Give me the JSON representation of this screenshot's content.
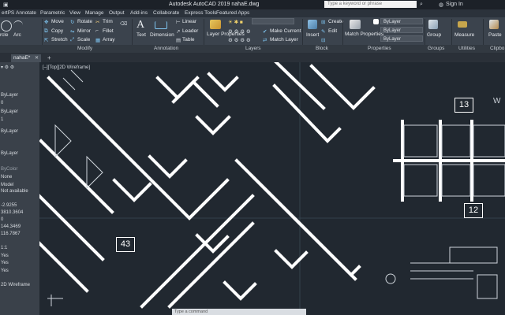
{
  "titlebar": {
    "title": "Autodesk AutoCAD 2019    nahaE.dwg",
    "search_placeholder": "Type a keyword or phrase",
    "signin": "Sign In"
  },
  "menu": [
    "ertPS",
    "Annotate",
    "Parametric",
    "View",
    "Manage",
    "Output",
    "Add-ins",
    "Collaborate",
    "Express Tools",
    "Featured Apps"
  ],
  "ribbon": {
    "draw": [
      "rcle",
      "Arc"
    ],
    "modify": [
      "Move",
      "Rotate",
      "Trim",
      "Copy",
      "Mirror",
      "Fillet",
      "Stretch",
      "Scale",
      "Array"
    ],
    "annotation": [
      "Text",
      "Dimension",
      "Linear",
      "Leader",
      "Table"
    ],
    "layers": [
      "Layer Properties",
      "Make Current",
      "Match Layer"
    ],
    "block": [
      "Insert",
      "Create",
      "Edit"
    ],
    "properties": [
      "Match Properties",
      "ByLayer",
      "ByLayer",
      "ByLayer"
    ],
    "groups": "Group",
    "utilities": "Measure",
    "clipboard": "Paste"
  },
  "panels": [
    "Modify",
    "Annotation",
    "Layers",
    "Block",
    "Properties",
    "Groups",
    "Utilities",
    "Clipbo"
  ],
  "file_tab": "nahaE*",
  "viewport_label": "[–][Top][2D Wireframe]",
  "properties_panel": [
    {
      "text": "ByLayer",
      "dim": false
    },
    {
      "text": "0",
      "dim": false
    },
    {
      "text": "ByLayer",
      "dim": false
    },
    {
      "text": "1",
      "dim": false
    },
    {
      "text": "ByLayer",
      "dim": false
    },
    {
      "text": "ByLayer",
      "dim": false
    },
    {
      "text": "ByColor",
      "dim": true
    },
    {
      "text": "None",
      "dim": false
    },
    {
      "text": "Model",
      "dim": false
    },
    {
      "text": "Not available",
      "dim": false
    },
    {
      "text": "-2.9255",
      "dim": false
    },
    {
      "text": "3810.3604",
      "dim": false
    },
    {
      "text": "0",
      "dim": false
    },
    {
      "text": "144.3469",
      "dim": false
    },
    {
      "text": "116.7867",
      "dim": false
    },
    {
      "text": "1:1",
      "dim": false
    },
    {
      "text": "Yes",
      "dim": false
    },
    {
      "text": "Yes",
      "dim": false
    },
    {
      "text": "Yes",
      "dim": false
    },
    {
      "text": "2D Wireframe",
      "dim": false
    }
  ],
  "room_labels": {
    "r13": "13",
    "r12": "12",
    "r43": "43"
  },
  "compass": "W",
  "command_placeholder": "Type a command"
}
